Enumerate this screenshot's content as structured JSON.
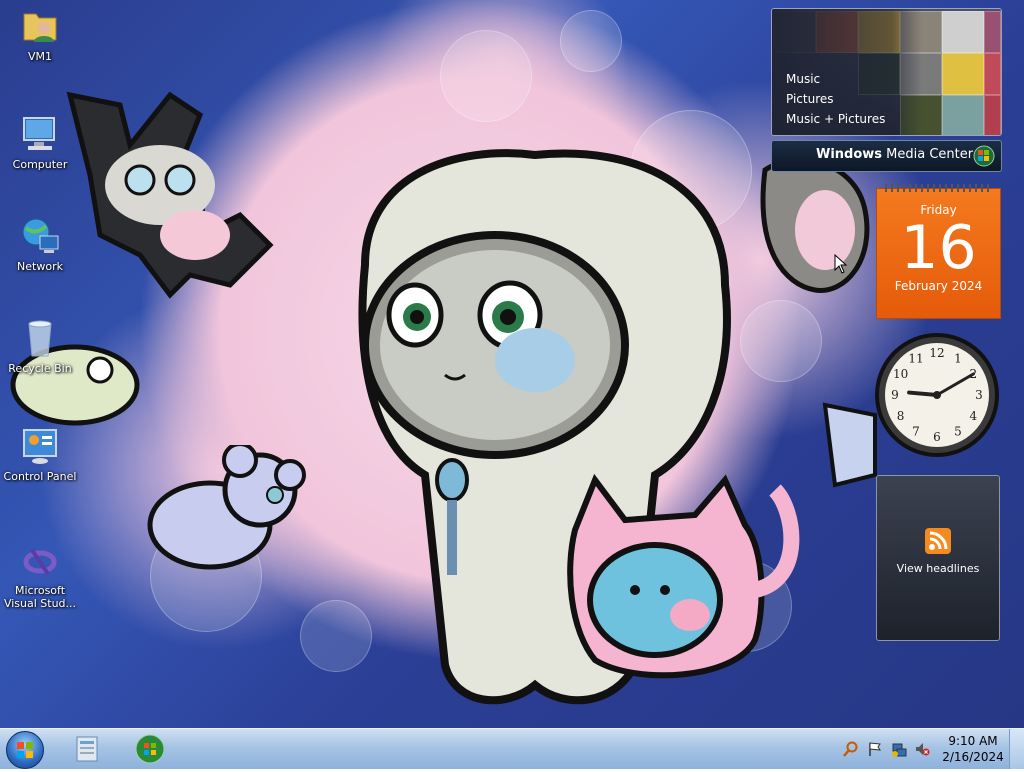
{
  "desktop_icons": [
    {
      "label": "VM1",
      "icon": "user-folder-icon"
    },
    {
      "label": "Computer",
      "icon": "computer-icon"
    },
    {
      "label": "Network",
      "icon": "network-icon"
    },
    {
      "label": "Recycle Bin",
      "icon": "recycle-bin-icon"
    },
    {
      "label": "Control Panel",
      "icon": "control-panel-icon"
    },
    {
      "label": "Microsoft Visual Stud...",
      "icon": "visual-studio-icon"
    }
  ],
  "media_center": {
    "menu": [
      "Music",
      "Pictures",
      "Music + Pictures"
    ],
    "brand_bold": "Windows",
    "brand_rest": " Media Center"
  },
  "calendar": {
    "weekday": "Friday",
    "day": "16",
    "month_year": "February 2024"
  },
  "clock": {
    "hour": 9,
    "minute": 10
  },
  "feed": {
    "label": "View headlines"
  },
  "taskbar": {
    "time": "9:10 AM",
    "date": "2/16/2024",
    "tray_icons": [
      "search-icon",
      "flag-icon",
      "network-status-icon",
      "volume-muted-icon"
    ]
  },
  "colors": {
    "calendar_orange": "#f0701a",
    "taskbar": "#a6c3e4",
    "wallpaper_blue": "#3557b6",
    "wallpaper_pink": "#f1c5db"
  }
}
